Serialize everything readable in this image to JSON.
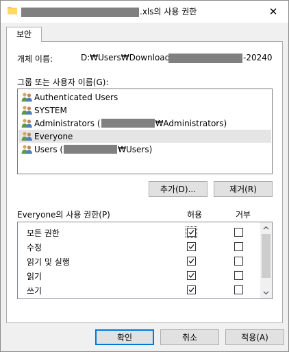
{
  "window": {
    "title_suffix": ".xls의 사용 권한",
    "close_glyph": "✕"
  },
  "tabs": [
    {
      "label": "보안"
    }
  ],
  "object": {
    "label": "개체 이름:",
    "path_prefix": "D:₩Users₩Downloads₩",
    "path_suffix": "-20240"
  },
  "principals": {
    "label": "그룹 또는 사용자 이름(G):",
    "items": [
      {
        "name": "Authenticated Users"
      },
      {
        "name": "SYSTEM"
      },
      {
        "name_prefix": "Administrators (",
        "name_suffix": "₩Administrators)"
      },
      {
        "name": "Everyone"
      },
      {
        "name_prefix": "Users (",
        "name_suffix": "₩Users)"
      }
    ],
    "selected_index": 3
  },
  "buttons": {
    "add": "추가(D)...",
    "remove": "제거(R)",
    "ok": "확인",
    "cancel": "취소",
    "apply": "적용(A)"
  },
  "permissions": {
    "header": "Everyone의 사용 권한(P)",
    "allow_label": "허용",
    "deny_label": "거부",
    "rows": [
      {
        "name": "모든 권한",
        "allow": true,
        "deny": false
      },
      {
        "name": "수정",
        "allow": true,
        "deny": false
      },
      {
        "name": "읽기 및 실행",
        "allow": true,
        "deny": false
      },
      {
        "name": "읽기",
        "allow": true,
        "deny": false
      },
      {
        "name": "쓰기",
        "allow": true,
        "deny": false
      }
    ]
  },
  "colors": {
    "default_button_border": "#0078d7",
    "selection_bg": "#e5e5e5",
    "redaction": "#808080"
  }
}
